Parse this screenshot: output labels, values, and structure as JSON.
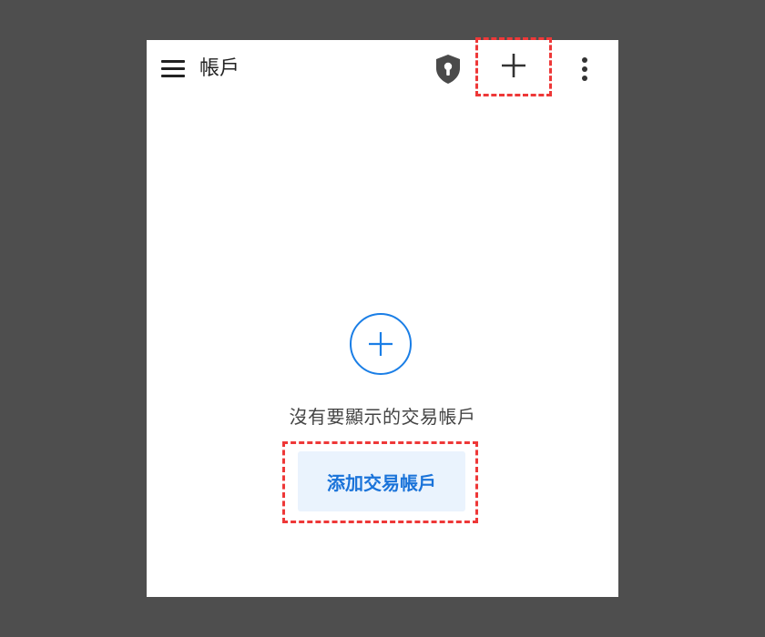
{
  "topbar": {
    "title": "帳戶",
    "icons": {
      "menu": "hamburger-menu-icon",
      "shield": "shield-keyhole-icon",
      "add": "plus-icon",
      "more": "more-vertical-icon"
    }
  },
  "empty_state": {
    "icon": "circle-plus-icon",
    "message": "沒有要顯示的交易帳戶",
    "button_label": "添加交易帳戶"
  },
  "colors": {
    "accent": "#1a7ee6",
    "button_bg": "#eaf3fd",
    "highlight": "#ee3838",
    "backdrop": "#4e4e4e"
  }
}
